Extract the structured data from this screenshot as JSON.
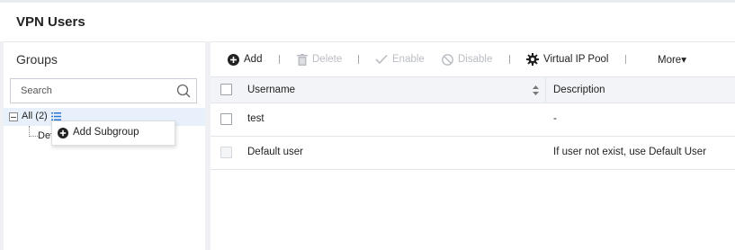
{
  "header": {
    "title": "VPN Users"
  },
  "groups": {
    "title": "Groups",
    "search_placeholder": "Search",
    "tree": {
      "all_label": "All (2)",
      "default_label": "Default user"
    },
    "context_menu": {
      "add_subgroup_label": "Add Subgroup"
    }
  },
  "toolbar": {
    "add_label": "Add",
    "delete_label": "Delete",
    "enable_label": "Enable",
    "disable_label": "Disable",
    "virtual_ip_pool_label": "Virtual IP Pool",
    "more_label": "More▾"
  },
  "table": {
    "columns": {
      "username": "Username",
      "description": "Description"
    },
    "rows": [
      {
        "username": "test",
        "description": "-"
      },
      {
        "username": "Default user",
        "description": "If user not exist, use Default User"
      }
    ]
  }
}
